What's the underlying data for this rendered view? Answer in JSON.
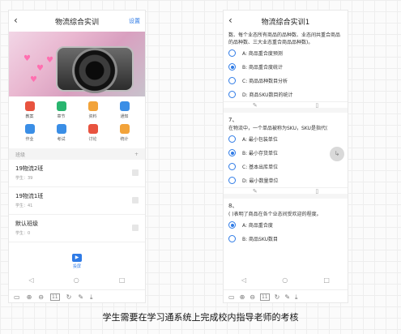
{
  "left": {
    "title": "物流综合实训",
    "header_action": "设置",
    "grid": [
      {
        "label": "教案",
        "icon": "lesson-plan-icon",
        "color": "#e8533f"
      },
      {
        "label": "章节",
        "icon": "chapter-icon",
        "color": "#29b56f"
      },
      {
        "label": "资料",
        "icon": "folder-icon",
        "color": "#f2a33a"
      },
      {
        "label": "通知",
        "icon": "megaphone-icon",
        "color": "#3a8ee6"
      },
      {
        "label": "作业",
        "icon": "homework-icon",
        "color": "#3a8ee6"
      },
      {
        "label": "考试",
        "icon": "exam-icon",
        "color": "#3a8ee6"
      },
      {
        "label": "讨论",
        "icon": "chat-icon",
        "color": "#e8533f"
      },
      {
        "label": "统计",
        "icon": "pie-icon",
        "color": "#f2a33a"
      }
    ],
    "section_label": "班级",
    "section_add": "+",
    "classes": [
      {
        "name": "19物流2班",
        "meta": "学生：39"
      },
      {
        "name": "19物流1班",
        "meta": "学生：41"
      },
      {
        "name": "默认班级",
        "meta": "学生：0"
      }
    ],
    "project_label": "投屏"
  },
  "right": {
    "title": "物流综合实训1",
    "q6_text": "数、每个业态所有商品的品种数、业态间共重合商品的品种数、三大业态重合商品品种数)。",
    "q6_options": [
      {
        "label": "A: 商品重合度预测",
        "selected": false
      },
      {
        "label": "B: 商品重合度统计",
        "selected": true
      },
      {
        "label": "C: 商品品种数目分析",
        "selected": false
      },
      {
        "label": "D: 商品SKU数目的统计",
        "selected": false
      }
    ],
    "q7_num": "7、",
    "q7_text": "在物流中，一个单品被称为SKU，SKU是指代(",
    "q7_options": [
      {
        "label": "A: 最小包装单位",
        "selected": false
      },
      {
        "label": "B: 最小存货单位",
        "selected": true
      },
      {
        "label": "C: 基本出库单位",
        "selected": false
      },
      {
        "label": "D: 最小数量单位",
        "selected": false
      }
    ],
    "q8_num": "8、",
    "q8_text": "( )表明了商品在各个业态间受欢迎的程度。",
    "q8_options": [
      {
        "label": "A: 商品重合度",
        "selected": true
      },
      {
        "label": "B: 商品SKU数目",
        "selected": false
      }
    ]
  },
  "nav": {
    "back": "◁",
    "home": "○",
    "recent": "□"
  },
  "toolbar": {
    "page": "11"
  },
  "caption": "学生需要在学习通系统上完成校内指导老师的考核"
}
